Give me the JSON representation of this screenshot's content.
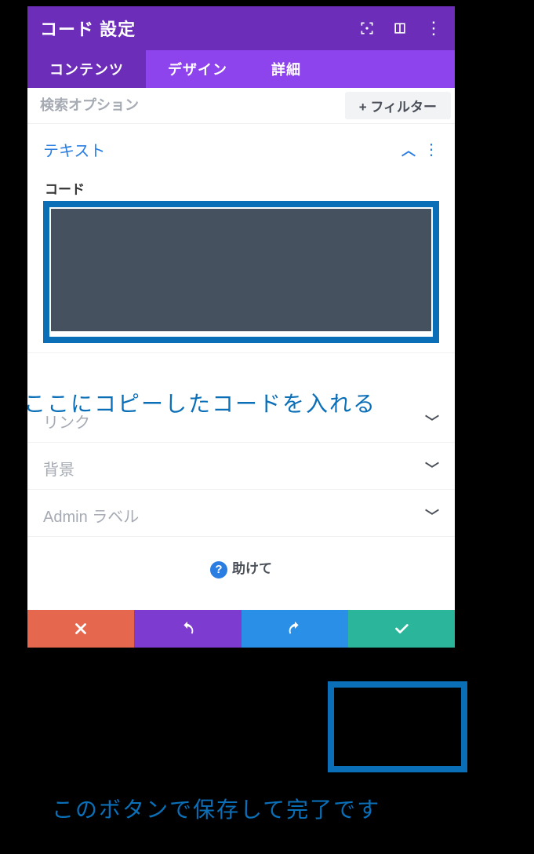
{
  "header": {
    "title": "コード 設定"
  },
  "tabs": {
    "content": "コンテンツ",
    "design": "デザイン",
    "detail": "詳細"
  },
  "search": {
    "placeholder": "検索オプション",
    "filter_label": "+ フィルター"
  },
  "sections": {
    "text": {
      "title": "テキスト",
      "code_label": "コード"
    },
    "link": {
      "title": "リンク"
    },
    "background": {
      "title": "背景"
    },
    "admin": {
      "title": "Admin ラベル"
    }
  },
  "help": {
    "label": "助けて"
  },
  "annotations": {
    "code": "ここにコピーしたコードを入れる",
    "save": "このボタンで保存して完了です"
  }
}
